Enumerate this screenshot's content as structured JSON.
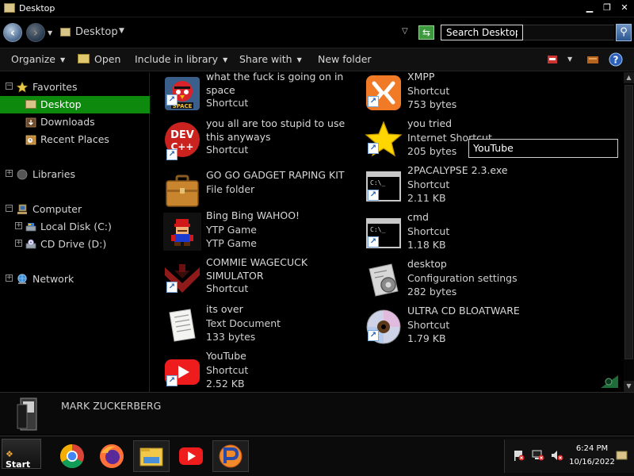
{
  "window": {
    "title": "Desktop",
    "minimize_glyph": "▁",
    "maximize_glyph": "❐",
    "close_glyph": "✕"
  },
  "address": {
    "back_glyph": "‹",
    "forward_glyph": "›",
    "location": "Desktop",
    "search_value": "Search Desktop"
  },
  "toolbar": {
    "organize": "Organize",
    "open": "Open",
    "include_in_library": "Include in library",
    "share_with": "Share with",
    "new_folder": "New folder"
  },
  "nav": {
    "favorites": "Favorites",
    "desktop": "Desktop",
    "downloads": "Downloads",
    "recent_places": "Recent Places",
    "libraries": "Libraries",
    "computer": "Computer",
    "local_disk": "Local Disk (C:)",
    "cd_drive": "CD Drive (D:)",
    "network": "Network"
  },
  "files": [
    {
      "name": "what the fuck is going on in space",
      "line1": "Shortcut",
      "line2": "",
      "icon": "angry-birds-icon"
    },
    {
      "name": "you all are too stupid to use this anyways",
      "line1": "Shortcut",
      "line2": "",
      "icon": "dev-cpp-icon"
    },
    {
      "name": "GO GO GADGET RAPING KIT",
      "line1": "File folder",
      "line2": "",
      "icon": "briefcase-icon"
    },
    {
      "name": "Bing Bing WAHOO!",
      "line1": "YTP Game",
      "line2": "YTP Game",
      "icon": "mario-icon"
    },
    {
      "name": "COMMIE WAGECUCK SIMULATOR",
      "line1": "Shortcut",
      "line2": "",
      "icon": "papers-please-icon"
    },
    {
      "name": "its over",
      "line1": "Text Document",
      "line2": "133 bytes",
      "icon": "text-document-icon"
    },
    {
      "name": "YouTube",
      "line1": "Shortcut",
      "line2": "2.52 KB",
      "icon": "youtube-icon"
    },
    {
      "name": "XMPP",
      "line1": "Shortcut",
      "line2": "753 bytes",
      "icon": "xampp-icon"
    },
    {
      "name": "you tried",
      "line1": "Internet Shortcut",
      "line2": "205 bytes",
      "icon": "star-icon"
    },
    {
      "name": "2PACALYPSE 2.3.exe",
      "line1": "Shortcut",
      "line2": "2.11 KB",
      "icon": "console-icon"
    },
    {
      "name": "cmd",
      "line1": "Shortcut",
      "line2": "1.18 KB",
      "icon": "console-icon"
    },
    {
      "name": "desktop",
      "line1": "Configuration settings",
      "line2": "282 bytes",
      "icon": "config-icon"
    },
    {
      "name": "ULTRA CD BLOATWARE",
      "line1": "Shortcut",
      "line2": "1.79 KB",
      "icon": "cd-icon"
    }
  ],
  "tooltip": "YouTube",
  "details": {
    "name": "MARK ZUCKERBERG"
  },
  "taskbar": {
    "start": "Start",
    "apps": [
      "chrome-icon",
      "firefox-icon",
      "file-explorer-icon",
      "youtube-icon",
      "pinball-icon"
    ],
    "time": "6:24 PM",
    "date": "10/16/2022"
  },
  "colors": {
    "selection": "#0d8a0d",
    "background": "#000000"
  }
}
